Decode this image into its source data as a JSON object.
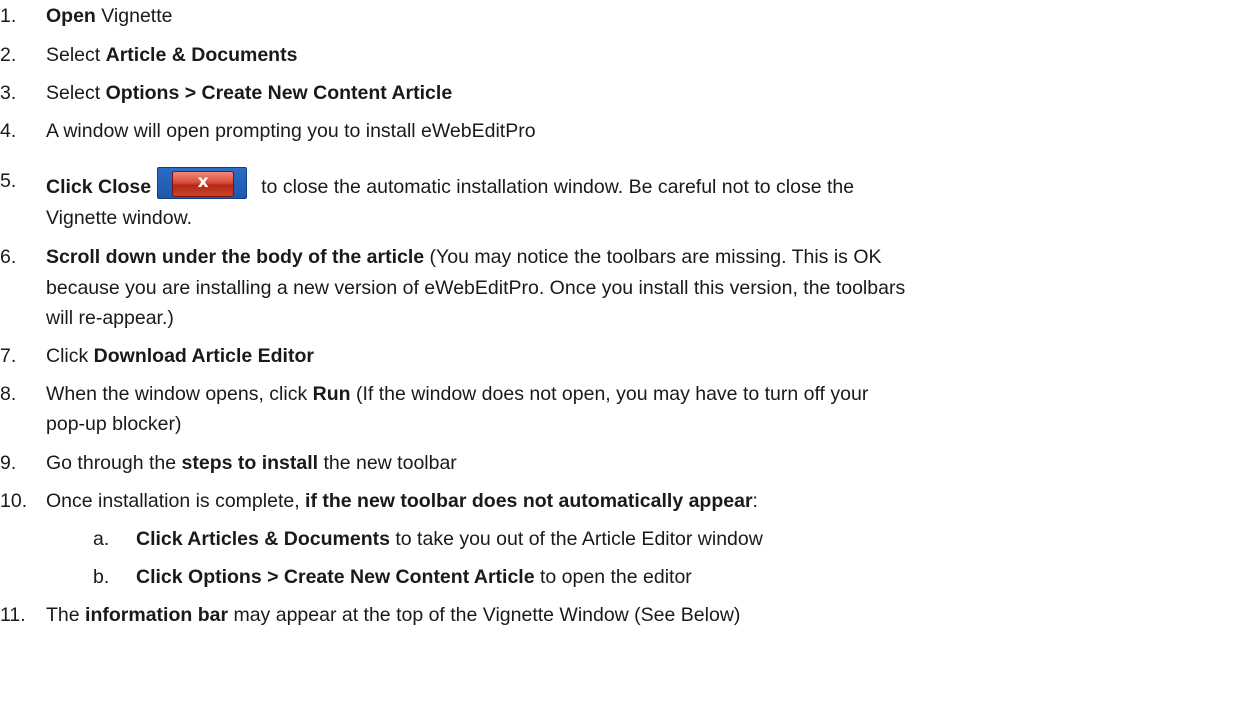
{
  "steps": [
    {
      "num": "1.",
      "bold": "Open",
      "rest": " Vignette"
    },
    {
      "num": "2.",
      "pre": "Select ",
      "bold": "Article & Documents"
    },
    {
      "num": "3.",
      "pre": "Select ",
      "bold": "Options > Create New Content Article"
    },
    {
      "num": "4.",
      "text": "A window will open prompting you to install eWebEditPro"
    },
    {
      "num": "5.",
      "bold": "Click Close",
      "rest": "to close the automatic installation window.  Be careful not to close the",
      "line2": "Vignette window."
    },
    {
      "num": "6.",
      "bold": "Scroll down under the body of the article",
      "rest": " (You may notice the toolbars are missing.  This is OK",
      "line2": "because you are installing a new version of eWebEditPro.  Once you install this version, the toolbars",
      "line3": "will re-appear.)"
    },
    {
      "num": "7.",
      "pre": "Click ",
      "bold": "Download Article Editor"
    },
    {
      "num": "8.",
      "pre": "When the window opens, click ",
      "bold": "Run",
      "rest": "  (If the window does not open, you may have to turn off your",
      "line2": "pop-up blocker)"
    },
    {
      "num": "9.",
      "pre": "Go through the ",
      "bold": "steps to install",
      "rest": " the new toolbar"
    },
    {
      "num": "10.",
      "pre": "Once installation is complete, ",
      "bold": "if the new toolbar does not automatically appear",
      "rest": ":"
    },
    {
      "num": "11.",
      "pre": "The ",
      "bold": "information bar",
      "rest": " may appear at the top of the Vignette Window (See Below)"
    }
  ],
  "substeps": [
    {
      "num": "a.",
      "bold": "Click Articles & Documents",
      "rest": " to take you out of the Article Editor window"
    },
    {
      "num": "b.",
      "bold": "Click Options > Create New Content Article",
      "rest": " to open the editor"
    }
  ],
  "close_button": {
    "glyph": "x",
    "icon": "close-x-icon"
  }
}
